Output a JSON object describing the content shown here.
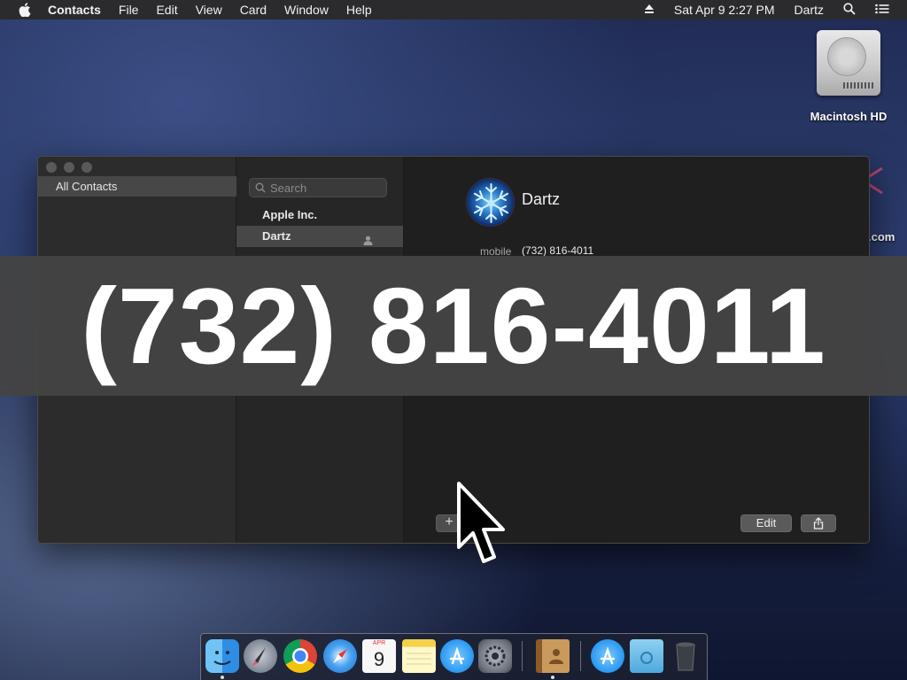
{
  "menubar": {
    "app_name": "Contacts",
    "menus": [
      "File",
      "Edit",
      "View",
      "Card",
      "Window",
      "Help"
    ],
    "date_time": "Sat Apr 9  2:27 PM",
    "user": "Dartz"
  },
  "desktop": {
    "drive_label": "Macintosh HD",
    "partial_label": ".com"
  },
  "window": {
    "groups": [
      "All Contacts"
    ],
    "search_placeholder": "Search",
    "contacts": [
      "Apple Inc.",
      "Dartz"
    ],
    "selected_contact": {
      "name": "Dartz",
      "phone_label": "mobile",
      "phone_value": "(732) 816-4011"
    },
    "buttons": {
      "add": "+",
      "edit": "Edit"
    }
  },
  "overlay": {
    "phone_large": "(732) 816-4011"
  },
  "dock": {
    "calendar_month": "APR",
    "calendar_day": "9",
    "apps": [
      "finder",
      "launchpad",
      "chrome",
      "safari",
      "calendar",
      "notes",
      "app-store",
      "system-preferences",
      "contacts",
      "app-store-downloads",
      "folder",
      "trash"
    ]
  }
}
